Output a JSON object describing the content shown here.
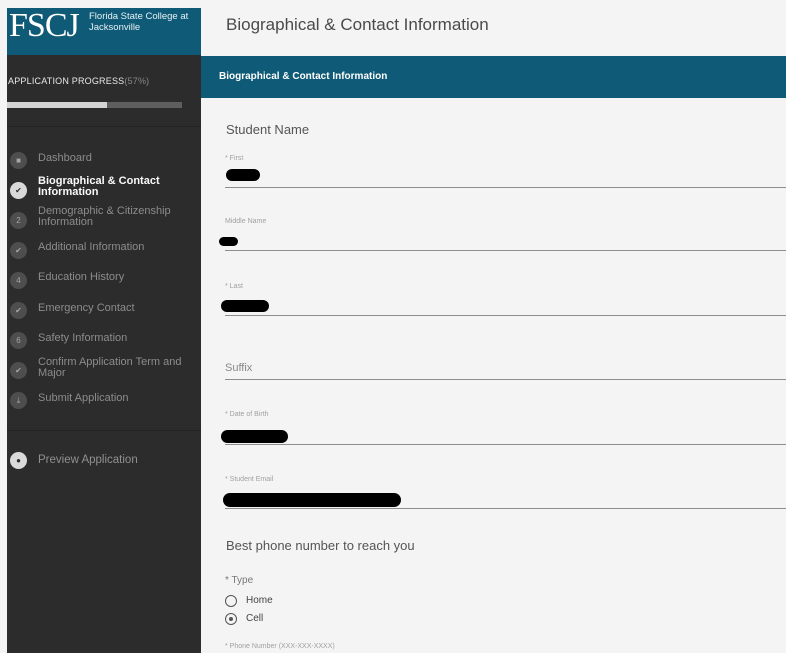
{
  "header": {
    "logo_mark": "FSCJ",
    "logo_text": "Florida State College at Jacksonville",
    "page_title": "Biographical & Contact Information"
  },
  "sidebar": {
    "progress_label": "APPLICATION PROGRESS",
    "progress_percent_text": "(57%)",
    "progress_fraction": 0.57,
    "steps": [
      {
        "badge": "■",
        "label": "Dashboard",
        "icon": "dashboard-icon"
      },
      {
        "badge": "✔",
        "label": "Biographical & Contact Information",
        "icon": "check-icon",
        "active": true
      },
      {
        "badge": "2",
        "label": "Demographic & Citizenship Information"
      },
      {
        "badge": "✔",
        "label": "Additional Information",
        "icon": "check-icon"
      },
      {
        "badge": "4",
        "label": "Education History"
      },
      {
        "badge": "✔",
        "label": "Emergency Contact",
        "icon": "check-icon"
      },
      {
        "badge": "6",
        "label": "Safety Information"
      },
      {
        "badge": "✔",
        "label": "Confirm Application Term and Major",
        "icon": "check-icon"
      },
      {
        "badge": "⤓",
        "label": "Submit Application",
        "icon": "download-icon"
      }
    ],
    "preview": {
      "badge": "●",
      "label": "Preview Application",
      "icon": "eye-icon"
    }
  },
  "main": {
    "section_header": "Biographical & Contact Information",
    "student_name_heading": "Student Name",
    "fields": {
      "first": {
        "label": "* First"
      },
      "middle": {
        "label": "Middle Name"
      },
      "last": {
        "label": "* Last"
      },
      "suffix": {
        "placeholder": "Suffix"
      },
      "dob": {
        "label": "* Date of Birth"
      },
      "email": {
        "label": "* Student Email"
      }
    },
    "phone_heading": "Best phone number to reach you",
    "type_label": "* Type",
    "type_options": [
      {
        "label": "Home",
        "checked": false
      },
      {
        "label": "Cell",
        "checked": true
      }
    ],
    "phone_label": "* Phone Number (XXX-XXX-XXXX)"
  }
}
